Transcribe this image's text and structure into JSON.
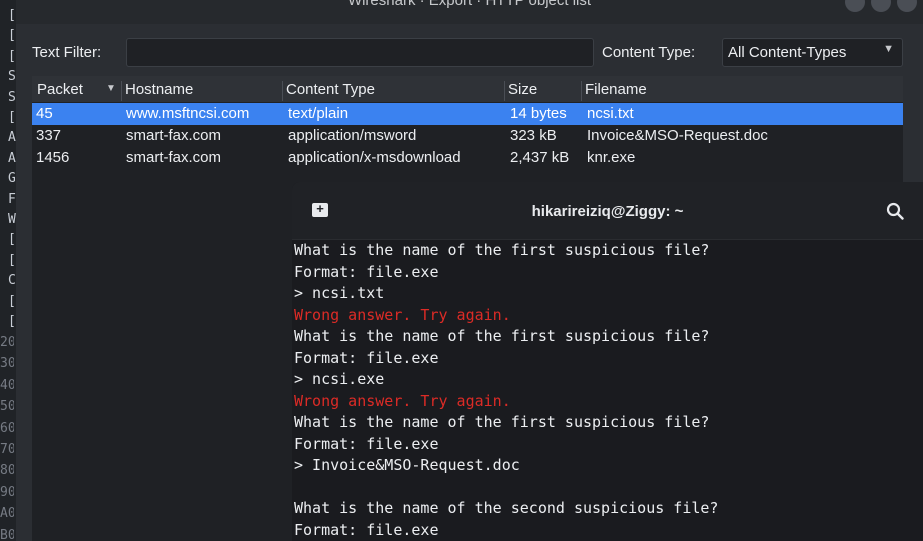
{
  "background": {
    "left_chars": [
      "[",
      "[",
      "[",
      "S",
      "S",
      "[",
      "A",
      "A",
      "G",
      "F",
      "W",
      "[",
      "[",
      "C",
      "[",
      "["
    ],
    "left_nums": [
      "20",
      "30",
      "40",
      "50",
      "60",
      "70",
      "80",
      "90",
      "A0",
      "B0"
    ]
  },
  "dialog": {
    "title": "Wireshark · Export · HTTP object list",
    "text_filter_label": "Text Filter:",
    "text_filter_value": "",
    "content_type_label": "Content Type:",
    "content_type_value": "All Content-Types",
    "columns": [
      "Packet",
      "Hostname",
      "Content Type",
      "Size",
      "Filename"
    ],
    "rows": [
      {
        "packet": "45",
        "hostname": "www.msftncsi.com",
        "content_type": "text/plain",
        "size": "14 bytes",
        "filename": "ncsi.txt",
        "selected": true
      },
      {
        "packet": "337",
        "hostname": "smart-fax.com",
        "content_type": "application/msword",
        "size": "323 kB",
        "filename": "Invoice&MSO-Request.doc",
        "selected": false
      },
      {
        "packet": "1456",
        "hostname": "smart-fax.com",
        "content_type": "application/x-msdownload",
        "size": "2,437 kB",
        "filename": "knr.exe",
        "selected": false
      }
    ]
  },
  "terminal": {
    "title": "hikarireiziq@Ziggy: ~",
    "lines": [
      {
        "text": "What is the name of the first suspicious file?",
        "type": "normal"
      },
      {
        "text": "Format: file.exe",
        "type": "normal"
      },
      {
        "text": "> ncsi.txt",
        "type": "normal"
      },
      {
        "text": "Wrong answer. Try again.",
        "type": "error"
      },
      {
        "text": "What is the name of the first suspicious file?",
        "type": "normal"
      },
      {
        "text": "Format: file.exe",
        "type": "normal"
      },
      {
        "text": "> ncsi.exe",
        "type": "normal"
      },
      {
        "text": "Wrong answer. Try again.",
        "type": "error"
      },
      {
        "text": "What is the name of the first suspicious file?",
        "type": "normal"
      },
      {
        "text": "Format: file.exe",
        "type": "normal"
      },
      {
        "text": "> Invoice&MSO-Request.doc",
        "type": "normal"
      },
      {
        "text": "",
        "type": "normal"
      },
      {
        "text": "What is the name of the second suspicious file?",
        "type": "normal"
      },
      {
        "text": "Format: file.exe",
        "type": "normal"
      }
    ]
  },
  "colors": {
    "selection": "#3b82f0",
    "error_text": "#dc2b26"
  }
}
